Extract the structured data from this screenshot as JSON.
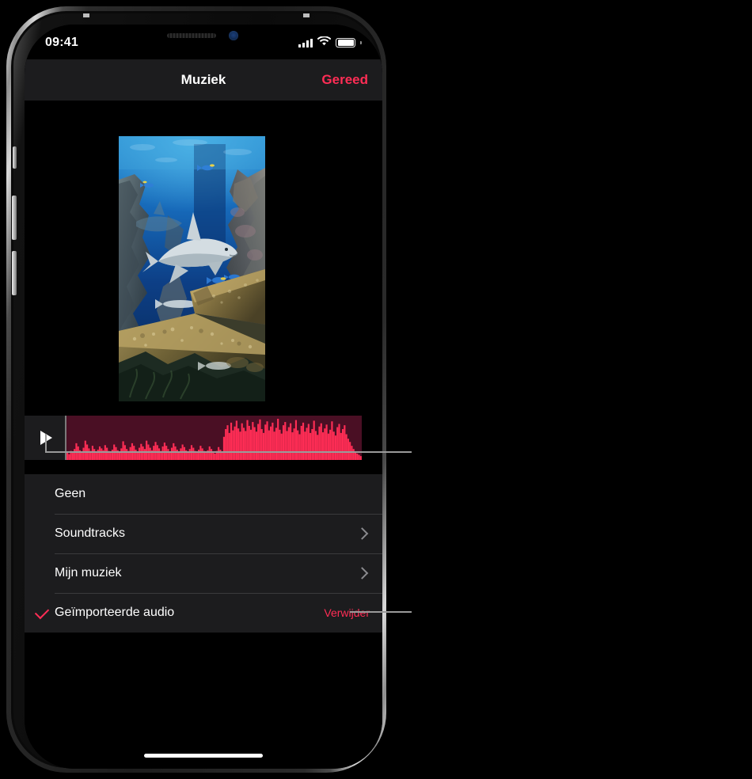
{
  "status_bar": {
    "time": "09:41",
    "cellular_icon": "signal-bars-icon",
    "wifi_icon": "wifi-icon",
    "battery_icon": "battery-full-icon"
  },
  "nav_bar": {
    "title": "Muziek",
    "done_label": "Gereed",
    "done_color": "#ff2d55"
  },
  "preview": {
    "media_alt": "Onderwaterscene met haai tussen koraalriffen",
    "play_icon": "play-icon"
  },
  "audio_track": {
    "waveform_color": "#ff2d55",
    "waveform_bg": "#4a0f24",
    "play_icon": "play-icon",
    "bars": [
      12,
      9,
      14,
      11,
      17,
      26,
      21,
      15,
      13,
      19,
      30,
      24,
      18,
      14,
      22,
      17,
      13,
      16,
      21,
      18,
      15,
      23,
      19,
      14,
      11,
      16,
      24,
      20,
      15,
      13,
      18,
      29,
      23,
      17,
      14,
      20,
      26,
      22,
      16,
      13,
      19,
      25,
      21,
      17,
      30,
      24,
      19,
      15,
      22,
      28,
      23,
      18,
      14,
      21,
      27,
      22,
      17,
      13,
      19,
      26,
      21,
      16,
      12,
      18,
      24,
      20,
      15,
      12,
      17,
      23,
      19,
      14,
      11,
      16,
      22,
      18,
      14,
      11,
      15,
      21,
      17,
      13,
      10,
      14,
      20,
      16,
      12,
      36,
      48,
      54,
      42,
      58,
      46,
      52,
      61,
      49,
      44,
      57,
      50,
      45,
      62,
      53,
      47,
      59,
      51,
      44,
      56,
      63,
      48,
      42,
      55,
      60,
      46,
      52,
      58,
      44,
      50,
      64,
      47,
      41,
      54,
      59,
      45,
      51,
      57,
      43,
      49,
      62,
      46,
      40,
      53,
      58,
      44,
      50,
      56,
      42,
      48,
      61,
      45,
      39,
      52,
      57,
      43,
      49,
      55,
      41,
      47,
      60,
      44,
      38,
      51,
      56,
      42,
      48,
      54,
      40,
      33,
      28,
      22,
      17,
      13,
      10,
      8,
      6
    ]
  },
  "options_list": {
    "items": [
      {
        "label": "Geen",
        "checked": false,
        "has_chevron": false,
        "action": null
      },
      {
        "label": "Soundtracks",
        "checked": false,
        "has_chevron": true,
        "action": null
      },
      {
        "label": "Mijn muziek",
        "checked": false,
        "has_chevron": true,
        "action": null
      },
      {
        "label": "Geïmporteerde audio",
        "checked": true,
        "has_chevron": false,
        "action": "Verwijder"
      }
    ],
    "action_color": "#ff2d55",
    "check_icon": "checkmark-icon",
    "chevron_icon": "chevron-right-icon"
  },
  "home_indicator": "home-indicator"
}
